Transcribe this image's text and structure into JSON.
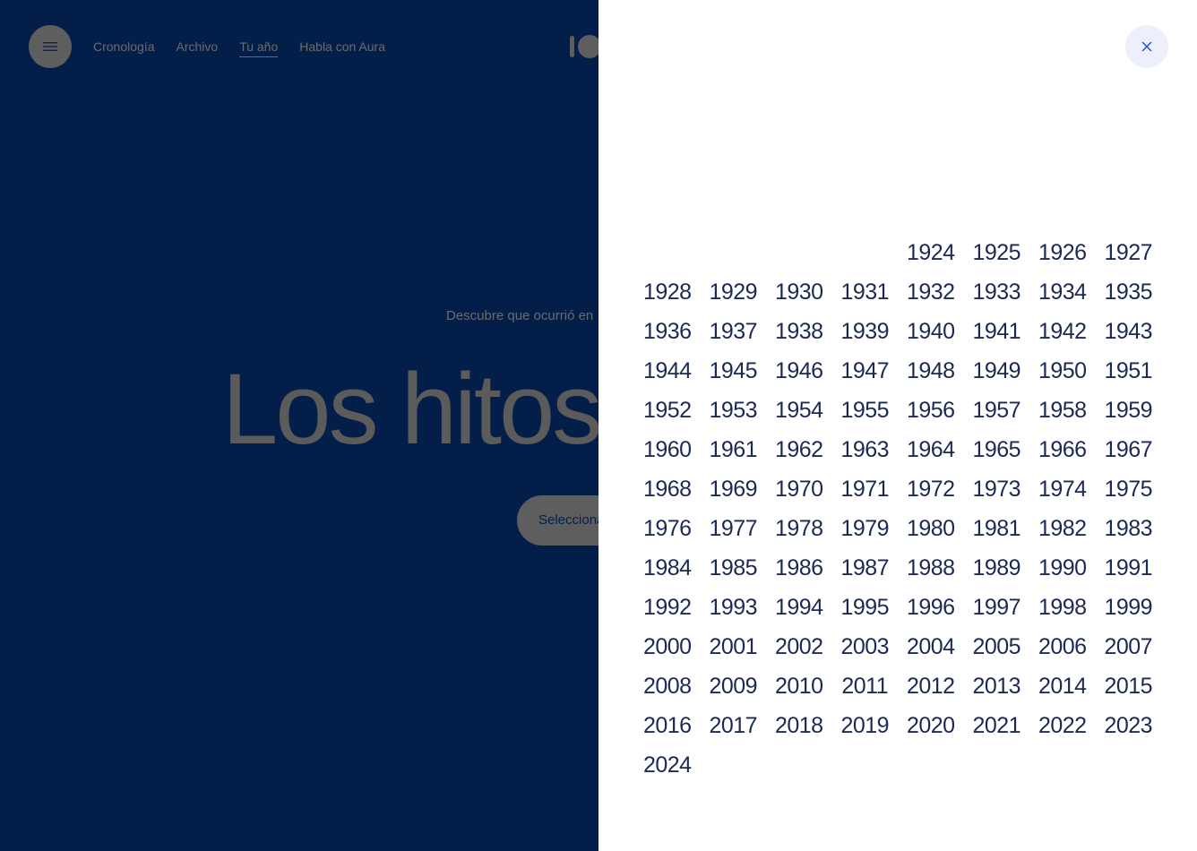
{
  "nav": {
    "items": [
      "Cronología",
      "Archivo",
      "Tu año",
      "Habla con Aura"
    ],
    "active": "Tu año"
  },
  "hero": {
    "subtitle": "Descubre que ocurrió en",
    "title": "Los hitos",
    "select_label": "Selecciona"
  },
  "panel": {
    "leading_blank_cells": 4,
    "years": [
      "1924",
      "1925",
      "1926",
      "1927",
      "1928",
      "1929",
      "1930",
      "1931",
      "1932",
      "1933",
      "1934",
      "1935",
      "1936",
      "1937",
      "1938",
      "1939",
      "1940",
      "1941",
      "1942",
      "1943",
      "1944",
      "1945",
      "1946",
      "1947",
      "1948",
      "1949",
      "1950",
      "1951",
      "1952",
      "1953",
      "1954",
      "1955",
      "1956",
      "1957",
      "1958",
      "1959",
      "1960",
      "1961",
      "1962",
      "1963",
      "1964",
      "1965",
      "1966",
      "1967",
      "1968",
      "1969",
      "1970",
      "1971",
      "1972",
      "1973",
      "1974",
      "1975",
      "1976",
      "1977",
      "1978",
      "1979",
      "1980",
      "1981",
      "1982",
      "1983",
      "1984",
      "1985",
      "1986",
      "1987",
      "1988",
      "1989",
      "1990",
      "1991",
      "1992",
      "1993",
      "1994",
      "1995",
      "1996",
      "1997",
      "1998",
      "1999",
      "2000",
      "2001",
      "2002",
      "2003",
      "2004",
      "2005",
      "2006",
      "2007",
      "2008",
      "2009",
      "2010",
      "2011",
      "2012",
      "2013",
      "2014",
      "2015",
      "2016",
      "2017",
      "2018",
      "2019",
      "2020",
      "2021",
      "2022",
      "2023",
      "2024"
    ]
  },
  "icons": {
    "menu": "hamburger-icon",
    "close": "close-icon",
    "logo": "logo-mark"
  },
  "colors": {
    "background": "#041e4a",
    "panel": "#ffffff",
    "year_text": "#1b2a55",
    "close_accent": "#1f4fd6",
    "close_bg": "#edeffa"
  }
}
